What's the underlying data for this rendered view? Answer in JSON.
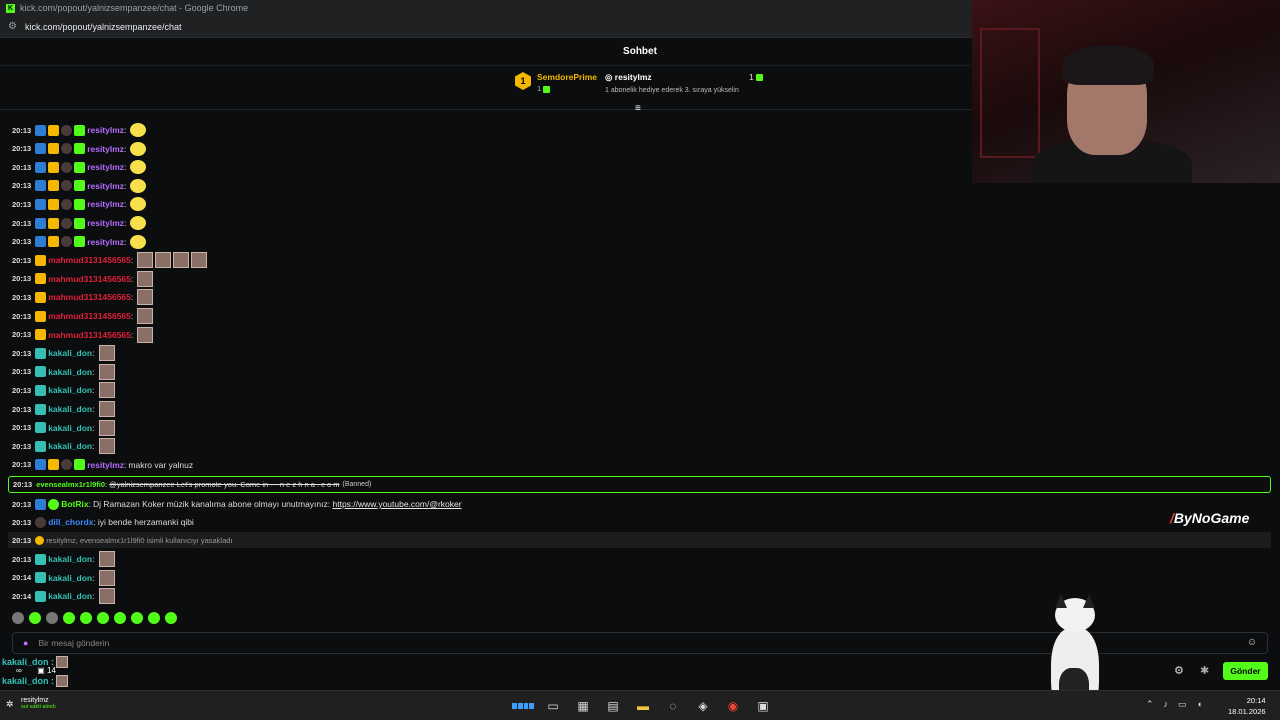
{
  "browser": {
    "window_title": "kick.com/popout/yalnizsempanzee/chat - Google Chrome",
    "url": "kick.com/popout/yalnizsempanzee/chat"
  },
  "chat": {
    "header": "Sohbet",
    "pinned": {
      "left_user": "SemdorePrime",
      "left_count": "1",
      "mid_user": "resitylmz",
      "mid_sub": "1 abonelik hediye ederek 3. sıraya yükselin",
      "right_count": "1"
    },
    "messages": [
      {
        "time": "20:13",
        "user": "resitylmz",
        "color": "purple",
        "badges": [
          "blue",
          "gold",
          "gray",
          "green"
        ],
        "text": "",
        "emotes": "yellow1"
      },
      {
        "time": "20:13",
        "user": "resitylmz",
        "color": "purple",
        "badges": [
          "blue",
          "gold",
          "gray",
          "green"
        ],
        "text": "",
        "emotes": "yellow1"
      },
      {
        "time": "20:13",
        "user": "resitylmz",
        "color": "purple",
        "badges": [
          "blue",
          "gold",
          "gray",
          "green"
        ],
        "text": "",
        "emotes": "yellow1"
      },
      {
        "time": "20:13",
        "user": "resitylmz",
        "color": "purple",
        "badges": [
          "blue",
          "gold",
          "gray",
          "green"
        ],
        "text": "",
        "emotes": "yellow1"
      },
      {
        "time": "20:13",
        "user": "resitylmz",
        "color": "purple",
        "badges": [
          "blue",
          "gold",
          "gray",
          "green"
        ],
        "text": "",
        "emotes": "yellow1"
      },
      {
        "time": "20:13",
        "user": "resitylmz",
        "color": "purple",
        "badges": [
          "blue",
          "gold",
          "gray",
          "green"
        ],
        "text": "",
        "emotes": "yellow1"
      },
      {
        "time": "20:13",
        "user": "resitylmz",
        "color": "purple",
        "badges": [
          "blue",
          "gold",
          "gray",
          "green"
        ],
        "text": "",
        "emotes": "yellow1"
      },
      {
        "time": "20:13",
        "user": "mahmud3131456565",
        "color": "red",
        "badges": [
          "gold"
        ],
        "text": "",
        "emotes": "face4"
      },
      {
        "time": "20:13",
        "user": "mahmud3131456565",
        "color": "red",
        "badges": [
          "gold"
        ],
        "text": "",
        "emotes": "face1"
      },
      {
        "time": "20:13",
        "user": "mahmud3131456565",
        "color": "red",
        "badges": [
          "gold"
        ],
        "text": "",
        "emotes": "face1"
      },
      {
        "time": "20:13",
        "user": "mahmud3131456565",
        "color": "red",
        "badges": [
          "gold"
        ],
        "text": "",
        "emotes": "face1"
      },
      {
        "time": "20:13",
        "user": "mahmud3131456565",
        "color": "red",
        "badges": [
          "gold"
        ],
        "text": "",
        "emotes": "face1"
      },
      {
        "time": "20:13",
        "user": "kakali_don",
        "color": "cyan",
        "badges": [
          "cyan"
        ],
        "text": "",
        "emotes": "face1"
      },
      {
        "time": "20:13",
        "user": "kakali_don",
        "color": "cyan",
        "badges": [
          "cyan"
        ],
        "text": "",
        "emotes": "face1"
      },
      {
        "time": "20:13",
        "user": "kakali_don",
        "color": "cyan",
        "badges": [
          "cyan"
        ],
        "text": "",
        "emotes": "face1"
      },
      {
        "time": "20:13",
        "user": "kakali_don",
        "color": "cyan",
        "badges": [
          "cyan"
        ],
        "text": "",
        "emotes": "face1"
      },
      {
        "time": "20:13",
        "user": "kakali_don",
        "color": "cyan",
        "badges": [
          "cyan"
        ],
        "text": "",
        "emotes": "face1"
      },
      {
        "time": "20:13",
        "user": "kakali_don",
        "color": "cyan",
        "badges": [
          "cyan"
        ],
        "text": "",
        "emotes": "face1"
      },
      {
        "time": "20:13",
        "user": "resitylmz",
        "color": "purple",
        "badges": [
          "blue",
          "gold",
          "gray",
          "green"
        ],
        "text": "makro var yalnuz",
        "emotes": ""
      }
    ],
    "banned_message": {
      "time": "20:13",
      "user": "evensealmx1r1l9fi0",
      "text": "@yalnizsempanzee Let's promote you. Come in --- n e z h n a . c o m",
      "tag": "(Banned)"
    },
    "bot_message": {
      "time": "20:13",
      "user": "BotRix",
      "text": "Dj Ramazan Koker müzik kanalıma abone olmayı unutmayınız:",
      "link": "https://www.youtube.com/@rkoker"
    },
    "dill_message": {
      "time": "20:13",
      "user": "dill_chordx",
      "text": "iyi bende herzamanki qibi"
    },
    "system_message": {
      "time": "20:13",
      "text": "resitylmz, evensealmx1r1l9fi0 isimli kullanıcıyı yasakladı"
    },
    "tail_messages": [
      {
        "time": "20:13",
        "user": "kakali_don"
      },
      {
        "time": "20:14",
        "user": "kakali_don"
      },
      {
        "time": "20:14",
        "user": "kakali_don"
      }
    ],
    "input_placeholder": "Bir mesaj gönderin",
    "send_label": "Gönder"
  },
  "watermark": "ByNoGame",
  "overlay": {
    "user1": "kakali_don :",
    "user2": "kakali_don :",
    "stat_inf": "∞",
    "stat_count": "14"
  },
  "taskbar": {
    "user": "resitylmz",
    "user_sub": "sui vakti alındı",
    "time": "20:14",
    "date": "18.01.2026"
  },
  "colors": {
    "kick_green": "#53fc18",
    "purple": "#b46cff",
    "red": "#e0203a",
    "cyan": "#35c0b4"
  }
}
